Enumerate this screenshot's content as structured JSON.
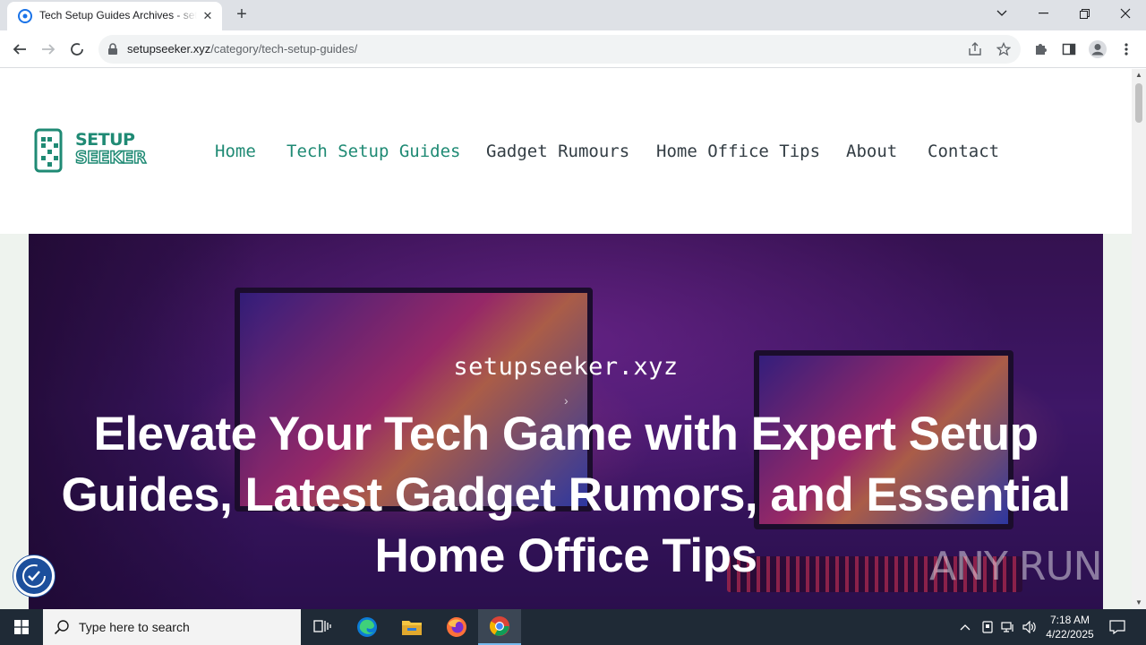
{
  "browser": {
    "tab_title": "Tech Setup Guides Archives - setupseeker.xyz",
    "url_host": "setupseeker.xyz",
    "url_path": "/category/tech-setup-guides/"
  },
  "site": {
    "logo_line1": "SETUP",
    "logo_line2": "SEEKER",
    "nav": [
      "Home",
      "Tech Setup Guides",
      "Gadget Rumours",
      "Home Office Tips",
      "About",
      "Contact"
    ]
  },
  "hero": {
    "domain": "setupseeker.xyz",
    "title": "Elevate Your Tech Game with Expert Setup Guides, Latest Gadget Rumors, and Essential Home Office Tips"
  },
  "watermark": "ANY RUN",
  "taskbar": {
    "search_placeholder": "Type here to search",
    "time": "7:18 AM",
    "date": "4/22/2025"
  },
  "colors": {
    "brand": "#1f8a74",
    "nav_text": "#333d44",
    "taskbar": "#1f2a36"
  },
  "icons": [
    "chrome-favicon",
    "close-icon",
    "plus-icon",
    "chevron-down-icon",
    "minimize-icon",
    "restore-icon",
    "back-arrow-icon",
    "forward-arrow-icon",
    "stop-loading-icon",
    "lock-icon",
    "share-icon",
    "star-icon",
    "extensions-icon",
    "sidepanel-icon",
    "profile-icon",
    "kebab-menu-icon",
    "accessibility-icon",
    "windows-start-icon",
    "search-icon",
    "task-view-icon",
    "edge-icon",
    "file-explorer-icon",
    "firefox-icon",
    "chrome-icon",
    "chevron-up-icon",
    "network-icon",
    "volume-icon",
    "notification-icon"
  ]
}
